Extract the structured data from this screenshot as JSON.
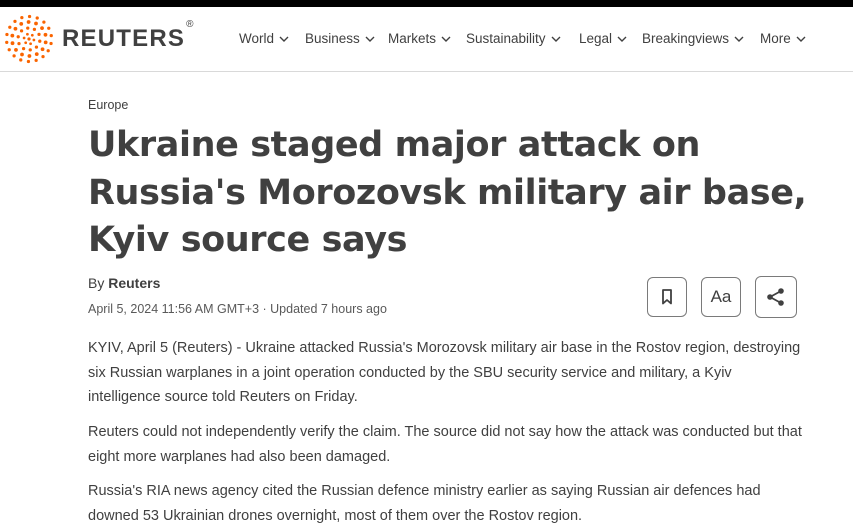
{
  "brand": {
    "name": "REUTERS",
    "registered": "®"
  },
  "nav": {
    "items": [
      {
        "label": "World"
      },
      {
        "label": "Business"
      },
      {
        "label": "Markets"
      },
      {
        "label": "Sustainability"
      },
      {
        "label": "Legal"
      },
      {
        "label": "Breakingviews"
      },
      {
        "label": "More"
      }
    ]
  },
  "article": {
    "kicker": "Europe",
    "headline": "Ukraine staged major attack on Russia's Morozovsk military air base, Kyiv source says",
    "byline_prefix": "By ",
    "author": "Reuters",
    "dateline": "April 5, 2024 11:56 AM GMT+3 · Updated 7 hours ago",
    "paragraphs": [
      "KYIV, April 5 (Reuters) - Ukraine attacked Russia's Morozovsk military air base in the Rostov region, destroying six Russian warplanes in a joint operation conducted by the SBU security service and military, a Kyiv intelligence source told Reuters on Friday.",
      "Reuters could not independently verify the claim. The source did not say how the attack was conducted but that eight more warplanes had also been damaged.",
      "Russia's RIA news agency cited the Russian defence ministry earlier as saying Russian air defences had downed 53 Ukrainian drones overnight, most of them over the Rostov region."
    ]
  },
  "actions": {
    "font_size_label": "Aa",
    "icons": [
      "bookmark-icon",
      "font-size-icon",
      "share-icon"
    ]
  },
  "colors": {
    "brand_orange": "#fa6400",
    "text": "#404040",
    "border": "#d9d9d9"
  }
}
